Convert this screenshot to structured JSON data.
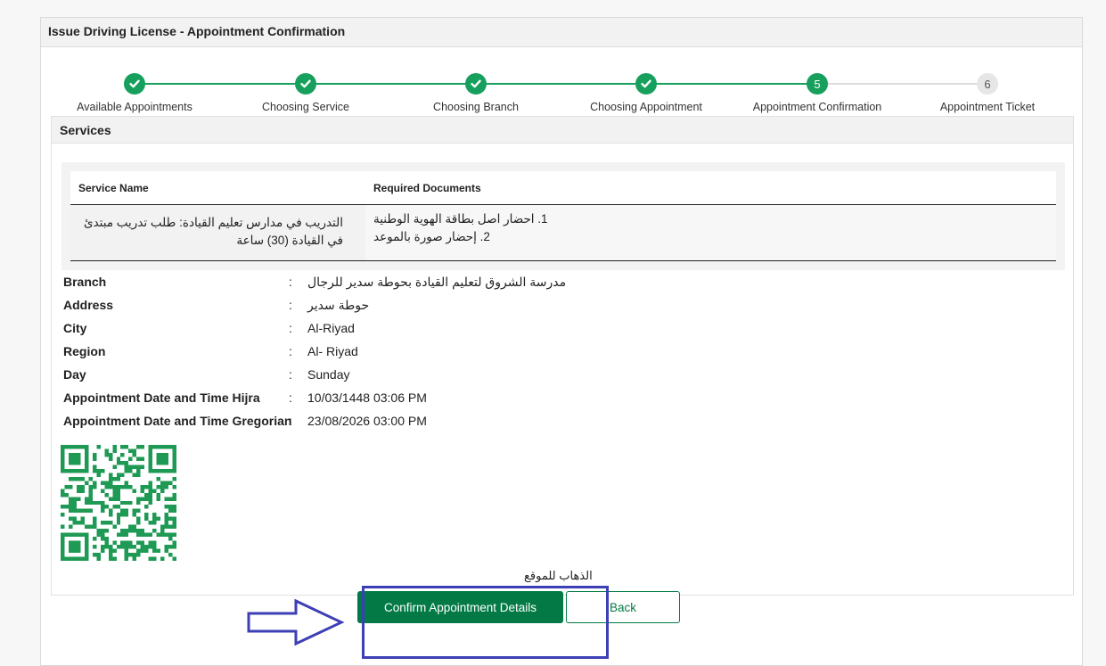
{
  "header": {
    "title": "Issue Driving License - Appointment Confirmation"
  },
  "stepper": {
    "steps": [
      {
        "number": "1",
        "label": "Available Appointments",
        "status": "done"
      },
      {
        "number": "2",
        "label": "Choosing Service",
        "status": "done"
      },
      {
        "number": "3",
        "label": "Choosing Branch",
        "status": "done"
      },
      {
        "number": "4",
        "label": "Choosing Appointment",
        "status": "done"
      },
      {
        "number": "5",
        "label": "Appointment Confirmation",
        "status": "current"
      },
      {
        "number": "6",
        "label": "Appointment Ticket",
        "status": "todo"
      }
    ]
  },
  "services": {
    "title": "Services",
    "columns": [
      "Service Name",
      "Required Documents"
    ],
    "row": {
      "service_name": "التدريب في مدارس تعليم القيادة: طلب تدريب مبتدئ في القيادة (30) ساعة",
      "documents": [
        "1. احضار اصل بطاقة الهوية الوطنية",
        "2. إحضار صورة بالموعد"
      ]
    }
  },
  "details": {
    "colon": ":",
    "rows": [
      {
        "label": "Branch",
        "value": "مدرسة الشروق لتعليم القيادة بحوطة سدير للرجال"
      },
      {
        "label": "Address",
        "value": "حوطة سدير"
      },
      {
        "label": "City",
        "value": "Al-Riyad"
      },
      {
        "label": "Region",
        "value": "Al- Riyad"
      },
      {
        "label": "Day",
        "value": "Sunday"
      },
      {
        "label": "Appointment Date and Time Hijra",
        "value": "10/03/1448 03:06 PM"
      },
      {
        "label": "Appointment Date and Time Gregorian",
        "value": "23/08/2026 03:00 PM"
      }
    ]
  },
  "map_link": "الذهاب للموقع",
  "buttons": {
    "confirm": "Confirm Appointment Details",
    "back": "Back"
  },
  "colors": {
    "accent": "#037a45",
    "step_done": "#17a05d",
    "highlight": "#3d3fb5"
  }
}
